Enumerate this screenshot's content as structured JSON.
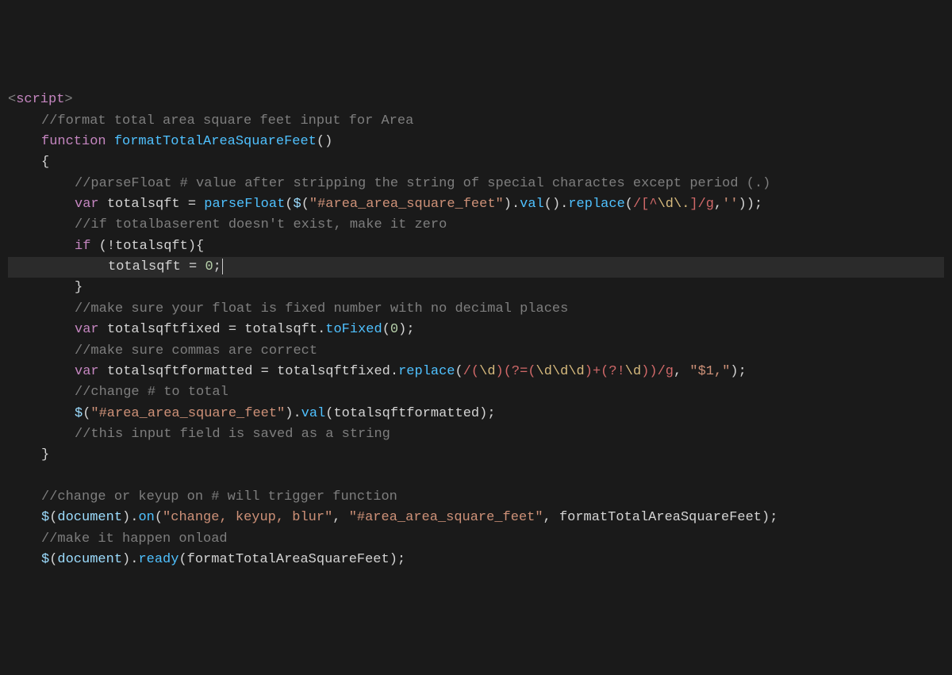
{
  "editor": {
    "language": "javascript",
    "highlighted_line_index": 8,
    "lines": [
      {
        "indent": 0,
        "tokens": [
          {
            "t": "tagbr",
            "v": "<"
          },
          {
            "t": "tagname",
            "v": "script"
          },
          {
            "t": "tagbr",
            "v": ">"
          }
        ]
      },
      {
        "indent": 1,
        "tokens": [
          {
            "t": "cmnt",
            "v": "//format total area square feet input for Area"
          }
        ]
      },
      {
        "indent": 1,
        "tokens": [
          {
            "t": "kw",
            "v": "function "
          },
          {
            "t": "fn",
            "v": "formatTotalAreaSquareFeet"
          },
          {
            "t": "paren",
            "v": "()"
          }
        ]
      },
      {
        "indent": 1,
        "tokens": [
          {
            "t": "punc",
            "v": "{"
          }
        ]
      },
      {
        "indent": 2,
        "tokens": [
          {
            "t": "cmnt",
            "v": "//parseFloat # value after stripping the string of special charactes except period (.)"
          }
        ]
      },
      {
        "indent": 2,
        "tokens": [
          {
            "t": "kw",
            "v": "var "
          },
          {
            "t": "id",
            "v": "totalsqft"
          },
          {
            "t": "op",
            "v": " = "
          },
          {
            "t": "call",
            "v": "parseFloat"
          },
          {
            "t": "paren",
            "v": "("
          },
          {
            "t": "glob",
            "v": "$"
          },
          {
            "t": "paren",
            "v": "("
          },
          {
            "t": "str",
            "v": "\"#area_area_square_feet\""
          },
          {
            "t": "paren",
            "v": ")"
          },
          {
            "t": "punc",
            "v": "."
          },
          {
            "t": "call",
            "v": "val"
          },
          {
            "t": "paren",
            "v": "()"
          },
          {
            "t": "punc",
            "v": "."
          },
          {
            "t": "call",
            "v": "replace"
          },
          {
            "t": "paren",
            "v": "("
          },
          {
            "t": "rgx",
            "v": "/[^"
          },
          {
            "t": "rgxesc",
            "v": "\\d\\."
          },
          {
            "t": "rgx",
            "v": "]/g"
          },
          {
            "t": "punc",
            "v": ","
          },
          {
            "t": "str",
            "v": "''"
          },
          {
            "t": "paren",
            "v": "))"
          },
          {
            "t": "punc",
            "v": ";"
          }
        ]
      },
      {
        "indent": 2,
        "tokens": [
          {
            "t": "cmnt",
            "v": "//if totalbaserent doesn't exist, make it zero"
          }
        ]
      },
      {
        "indent": 2,
        "tokens": [
          {
            "t": "kw",
            "v": "if "
          },
          {
            "t": "paren",
            "v": "("
          },
          {
            "t": "op",
            "v": "!"
          },
          {
            "t": "id",
            "v": "totalsqft"
          },
          {
            "t": "paren",
            "v": ")"
          },
          {
            "t": "punc",
            "v": "{"
          }
        ]
      },
      {
        "indent": 3,
        "hl": true,
        "tokens": [
          {
            "t": "id",
            "v": "totalsqft"
          },
          {
            "t": "op",
            "v": " = "
          },
          {
            "t": "num",
            "v": "0"
          },
          {
            "t": "punc",
            "v": ";"
          },
          {
            "t": "cursor",
            "v": ""
          }
        ]
      },
      {
        "indent": 2,
        "tokens": [
          {
            "t": "punc",
            "v": "}"
          }
        ]
      },
      {
        "indent": 2,
        "tokens": [
          {
            "t": "cmnt",
            "v": "//make sure your float is fixed number with no decimal places"
          }
        ]
      },
      {
        "indent": 2,
        "tokens": [
          {
            "t": "kw",
            "v": "var "
          },
          {
            "t": "id",
            "v": "totalsqftfixed"
          },
          {
            "t": "op",
            "v": " = "
          },
          {
            "t": "id",
            "v": "totalsqft"
          },
          {
            "t": "punc",
            "v": "."
          },
          {
            "t": "call",
            "v": "toFixed"
          },
          {
            "t": "paren",
            "v": "("
          },
          {
            "t": "num",
            "v": "0"
          },
          {
            "t": "paren",
            "v": ")"
          },
          {
            "t": "punc",
            "v": ";"
          }
        ]
      },
      {
        "indent": 2,
        "tokens": [
          {
            "t": "cmnt",
            "v": "//make sure commas are correct"
          }
        ]
      },
      {
        "indent": 2,
        "tokens": [
          {
            "t": "kw",
            "v": "var "
          },
          {
            "t": "id",
            "v": "totalsqftformatted"
          },
          {
            "t": "op",
            "v": " = "
          },
          {
            "t": "id",
            "v": "totalsqftfixed"
          },
          {
            "t": "punc",
            "v": "."
          },
          {
            "t": "call",
            "v": "replace"
          },
          {
            "t": "paren",
            "v": "("
          },
          {
            "t": "rgx",
            "v": "/("
          },
          {
            "t": "rgxesc",
            "v": "\\d"
          },
          {
            "t": "rgx",
            "v": ")(?=("
          },
          {
            "t": "rgxesc",
            "v": "\\d\\d\\d"
          },
          {
            "t": "rgx",
            "v": ")+(?!"
          },
          {
            "t": "rgxesc",
            "v": "\\d"
          },
          {
            "t": "rgx",
            "v": "))/g"
          },
          {
            "t": "punc",
            "v": ", "
          },
          {
            "t": "str",
            "v": "\"$1,\""
          },
          {
            "t": "paren",
            "v": ")"
          },
          {
            "t": "punc",
            "v": ";"
          }
        ]
      },
      {
        "indent": 2,
        "tokens": [
          {
            "t": "cmnt",
            "v": "//change # to total"
          }
        ]
      },
      {
        "indent": 2,
        "tokens": [
          {
            "t": "glob",
            "v": "$"
          },
          {
            "t": "paren",
            "v": "("
          },
          {
            "t": "str",
            "v": "\"#area_area_square_feet\""
          },
          {
            "t": "paren",
            "v": ")"
          },
          {
            "t": "punc",
            "v": "."
          },
          {
            "t": "call",
            "v": "val"
          },
          {
            "t": "paren",
            "v": "("
          },
          {
            "t": "id",
            "v": "totalsqftformatted"
          },
          {
            "t": "paren",
            "v": ")"
          },
          {
            "t": "punc",
            "v": ";"
          }
        ]
      },
      {
        "indent": 2,
        "tokens": [
          {
            "t": "cmnt",
            "v": "//this input field is saved as a string"
          }
        ]
      },
      {
        "indent": 1,
        "tokens": [
          {
            "t": "punc",
            "v": "}"
          }
        ]
      },
      {
        "indent": 0,
        "tokens": []
      },
      {
        "indent": 1,
        "tokens": [
          {
            "t": "cmnt",
            "v": "//change or keyup on # will trigger function"
          }
        ]
      },
      {
        "indent": 1,
        "tokens": [
          {
            "t": "glob",
            "v": "$"
          },
          {
            "t": "paren",
            "v": "("
          },
          {
            "t": "glob",
            "v": "document"
          },
          {
            "t": "paren",
            "v": ")"
          },
          {
            "t": "punc",
            "v": "."
          },
          {
            "t": "call",
            "v": "on"
          },
          {
            "t": "paren",
            "v": "("
          },
          {
            "t": "str",
            "v": "\"change, keyup, blur\""
          },
          {
            "t": "punc",
            "v": ", "
          },
          {
            "t": "str",
            "v": "\"#area_area_square_feet\""
          },
          {
            "t": "punc",
            "v": ", "
          },
          {
            "t": "id",
            "v": "formatTotalAreaSquareFeet"
          },
          {
            "t": "paren",
            "v": ")"
          },
          {
            "t": "punc",
            "v": ";"
          }
        ]
      },
      {
        "indent": 1,
        "tokens": [
          {
            "t": "cmnt",
            "v": "//make it happen onload"
          }
        ]
      },
      {
        "indent": 1,
        "tokens": [
          {
            "t": "glob",
            "v": "$"
          },
          {
            "t": "paren",
            "v": "("
          },
          {
            "t": "glob",
            "v": "document"
          },
          {
            "t": "paren",
            "v": ")"
          },
          {
            "t": "punc",
            "v": "."
          },
          {
            "t": "call",
            "v": "ready"
          },
          {
            "t": "paren",
            "v": "("
          },
          {
            "t": "id",
            "v": "formatTotalAreaSquareFeet"
          },
          {
            "t": "paren",
            "v": ")"
          },
          {
            "t": "punc",
            "v": ";"
          }
        ]
      }
    ]
  }
}
